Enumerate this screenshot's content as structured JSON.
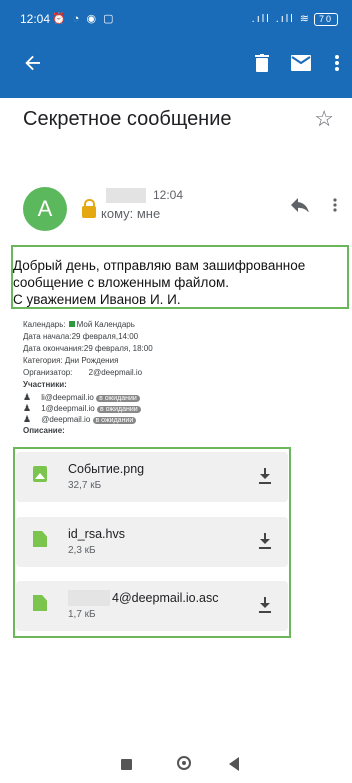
{
  "status_bar": {
    "time": "12:04",
    "left_icons": "⏰ ◔ ◉ ▢",
    "right_icons": ".ıll .ıll ≋",
    "battery": "70"
  },
  "toolbar": {
    "back_icon": "arrow-left-icon",
    "delete_icon": "trash-icon",
    "mark_unread_icon": "mail-icon",
    "more_icon": "more-vert-icon"
  },
  "message": {
    "subject": "Секретное сообщение",
    "time": "12:04",
    "avatar_letter": "A",
    "to_label": "кому: мне",
    "body_lines": [
      "Добрый день, отправляю вам зашифрованное",
      "сообщение с вложенным файлом.",
      "С уважением Иванов И. И."
    ]
  },
  "calendar": {
    "calendar_label": "Календарь:",
    "calendar_value": "Мой Календарь",
    "start": "Дата начала:29 февраля,14:00",
    "end": "Дата окончания:29 февраля, 18:00",
    "category": "Категория: Дни Рождения",
    "organizer_label": "Организатор:",
    "organizer_value": "2@deepmail.io",
    "participants_label": "Участники:",
    "participants": [
      {
        "email": "li@deepmail.io",
        "status": "в ожидании"
      },
      {
        "email": "1@deepmail.io",
        "status": "в ожидании"
      },
      {
        "email": "@deepmail.io",
        "status": "в ожидании"
      }
    ],
    "description_label": "Описание:"
  },
  "attachments": [
    {
      "name": "Событие.png",
      "size": "32,7 кБ",
      "icon": "image-icon"
    },
    {
      "name": "id_rsa.hvs",
      "size": "2,3 кБ",
      "icon": "file-icon"
    },
    {
      "name": "4@deepmail.io.asc",
      "size": "1,7 кБ",
      "icon": "file-icon"
    }
  ],
  "colors": {
    "app_bar": "#1a6bb8",
    "avatar": "#5cb85c",
    "highlight_border": "#6bb85c",
    "file_icon": "#7bc44d",
    "lock": "#e5a812"
  }
}
